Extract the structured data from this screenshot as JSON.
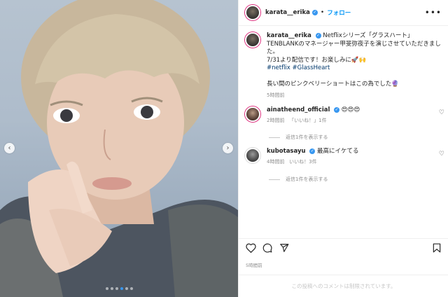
{
  "post": {
    "username": "karata__erika",
    "separator": "•",
    "follow_label": "フォロー",
    "more_icon": "more-horizontal-icon",
    "caption": {
      "username": "karata__erika",
      "line1": "Netflixシリーズ「グラスハート」",
      "line2": "TENBLANKのマネージャー甲斐弥夜子を演じさせていただきました。",
      "line3": "7/31より配信です！お楽しみに🚀🙌",
      "hashtags": "#netflix #GlassHeart",
      "line4": "長い間のピンクベリーショートはこの為でした🔮",
      "time": "5時間前"
    },
    "comments": [
      {
        "username": "ainatheend_official",
        "text": "😍😍😍",
        "time": "2時間前",
        "likes": "「いいね！」1件",
        "replies_label": "返信1件を表示する"
      },
      {
        "username": "kubotasayu",
        "text": "最高にイケてる",
        "time": "4時間前",
        "likes": "いいね！3件",
        "replies_label": "返信1件を表示する"
      }
    ],
    "posted_time": "5時間前",
    "comments_limited": "この投稿へのコメントは制限されています。"
  },
  "carousel": {
    "total": 6,
    "active": 3
  },
  "colors": {
    "accent": "#0095f6",
    "verified": "#3897f0",
    "muted": "#8e8e8e"
  }
}
